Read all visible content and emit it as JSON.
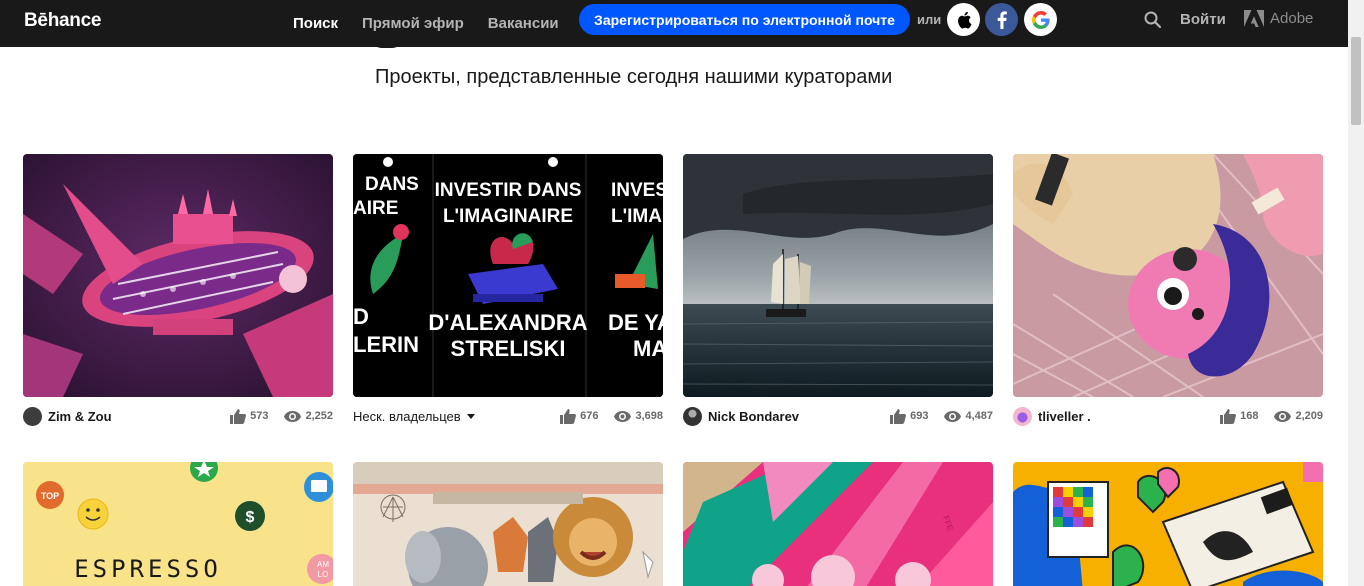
{
  "header": {
    "logo": "Bēhance",
    "nav": [
      "Поиск",
      "Прямой эфир",
      "Вакансии"
    ],
    "signup_label": "Зарегистрироваться по электронной почте",
    "or_label": "или",
    "login_label": "Войти",
    "adobe_label": "Adobe"
  },
  "main": {
    "subtitle": "Проекты, представленные сегодня нашими кураторами"
  },
  "projects": [
    {
      "owner": "Zim & Zou",
      "likes": "573",
      "views": "2,252"
    },
    {
      "owner": "Неск. владельцев",
      "likes": "676",
      "views": "3,698",
      "poster": {
        "left_line1": "DANS",
        "left_line2": "AIRE",
        "left_line3": "D",
        "left_line4": "LERIN",
        "center_line1": "INVESTIR DANS",
        "center_line2": "L'IMAGINAIRE",
        "center_line3": "D'ALEXANDRA",
        "center_line4": "STRELISKI",
        "right_line1": "INVEST",
        "right_line2": "L'IMA",
        "right_line3": "DE YAN",
        "right_line4": "MA"
      }
    },
    {
      "owner": "Nick Bondarev",
      "likes": "693",
      "views": "4,487"
    },
    {
      "owner": "tliveller .",
      "likes": "168",
      "views": "2,209"
    }
  ],
  "row2": [
    {
      "text": "ESPRESSO",
      "badge_top": "TOP",
      "badge_amlo": "AM\nLO"
    },
    {},
    {},
    {}
  ],
  "colors": {
    "topbar": "#191919",
    "signup": "#0057ff",
    "facebook": "#3b5998"
  }
}
